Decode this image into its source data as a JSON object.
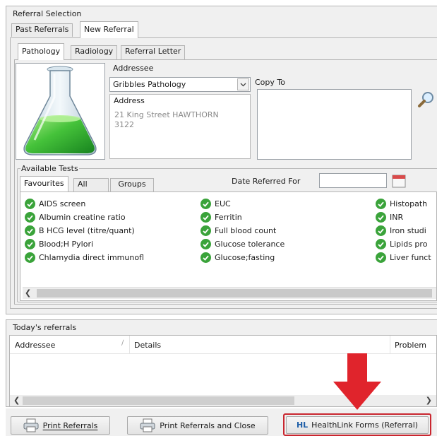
{
  "window": {
    "title": "Referral Selection",
    "top_tabs": [
      "Past Referrals",
      "New Referral"
    ],
    "sub_tabs": [
      "Pathology",
      "Radiology",
      "Referral Letter"
    ]
  },
  "addressee": {
    "label": "Addressee",
    "value": "Gribbles Pathology",
    "address_label": "Address",
    "address_line1": "21 King Street HAWTHORN",
    "address_line2": "3122"
  },
  "copy_to": {
    "label": "Copy To"
  },
  "tests": {
    "label": "Available Tests",
    "tabs": [
      "Favourites",
      "All",
      "Groups"
    ],
    "date_label": "Date Referred For",
    "col1": [
      "AIDS screen",
      "Albumin creatine ratio",
      "B HCG level (titre/quant)",
      "Blood;H Pylori",
      "Chlamydia direct immunofl"
    ],
    "col2": [
      "EUC",
      "Ferritin",
      "Full blood count",
      "Glucose tolerance",
      "Glucose;fasting"
    ],
    "col3": [
      "Histopath",
      "INR",
      "Iron studi",
      "Lipids pro",
      "Liver funct"
    ]
  },
  "todays": {
    "label": "Today's referrals",
    "columns": [
      "Addressee",
      "Details",
      "Problem"
    ]
  },
  "buttons": {
    "print": "Print Referrals",
    "print_close": "Print Referrals and Close",
    "healthlink_badge": "HL",
    "healthlink": "HealthLink Forms (Referral)"
  },
  "colors": {
    "check": "#3aa33a",
    "highlight": "#c9262f",
    "arrow": "#e0242c"
  }
}
